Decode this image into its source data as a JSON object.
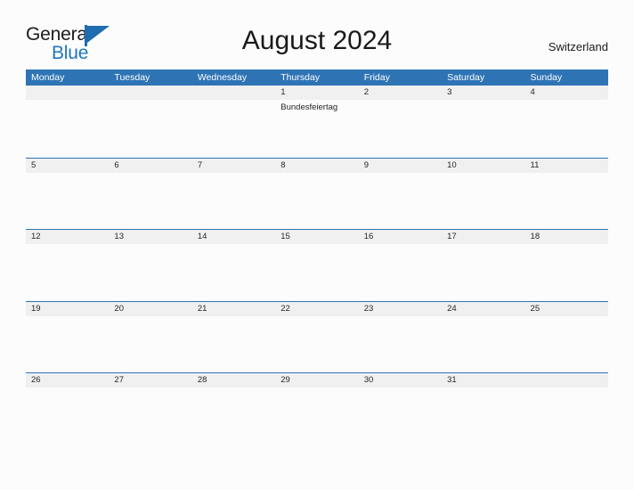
{
  "logo": {
    "text_primary": "General",
    "text_secondary": "Blue",
    "mark": "blue-triangle-flag"
  },
  "header": {
    "title": "August 2024",
    "region": "Switzerland"
  },
  "calendar": {
    "weekday_headers": [
      "Monday",
      "Tuesday",
      "Wednesday",
      "Thursday",
      "Friday",
      "Saturday",
      "Sunday"
    ],
    "weeks": [
      [
        {
          "day": "",
          "events": []
        },
        {
          "day": "",
          "events": []
        },
        {
          "day": "",
          "events": []
        },
        {
          "day": "1",
          "events": [
            "Bundesfeiertag"
          ]
        },
        {
          "day": "2",
          "events": []
        },
        {
          "day": "3",
          "events": []
        },
        {
          "day": "4",
          "events": []
        }
      ],
      [
        {
          "day": "5",
          "events": []
        },
        {
          "day": "6",
          "events": []
        },
        {
          "day": "7",
          "events": []
        },
        {
          "day": "8",
          "events": []
        },
        {
          "day": "9",
          "events": []
        },
        {
          "day": "10",
          "events": []
        },
        {
          "day": "11",
          "events": []
        }
      ],
      [
        {
          "day": "12",
          "events": []
        },
        {
          "day": "13",
          "events": []
        },
        {
          "day": "14",
          "events": []
        },
        {
          "day": "15",
          "events": []
        },
        {
          "day": "16",
          "events": []
        },
        {
          "day": "17",
          "events": []
        },
        {
          "day": "18",
          "events": []
        }
      ],
      [
        {
          "day": "19",
          "events": []
        },
        {
          "day": "20",
          "events": []
        },
        {
          "day": "21",
          "events": []
        },
        {
          "day": "22",
          "events": []
        },
        {
          "day": "23",
          "events": []
        },
        {
          "day": "24",
          "events": []
        },
        {
          "day": "25",
          "events": []
        }
      ],
      [
        {
          "day": "26",
          "events": []
        },
        {
          "day": "27",
          "events": []
        },
        {
          "day": "28",
          "events": []
        },
        {
          "day": "29",
          "events": []
        },
        {
          "day": "30",
          "events": []
        },
        {
          "day": "31",
          "events": []
        },
        {
          "day": "",
          "events": []
        }
      ]
    ]
  },
  "colors": {
    "header_blue": "#2e74b5",
    "band_gray": "#f0f0f0",
    "logo_blue": "#2077c0",
    "page_background": "#fcfcfc",
    "text_dark": "#262626"
  }
}
